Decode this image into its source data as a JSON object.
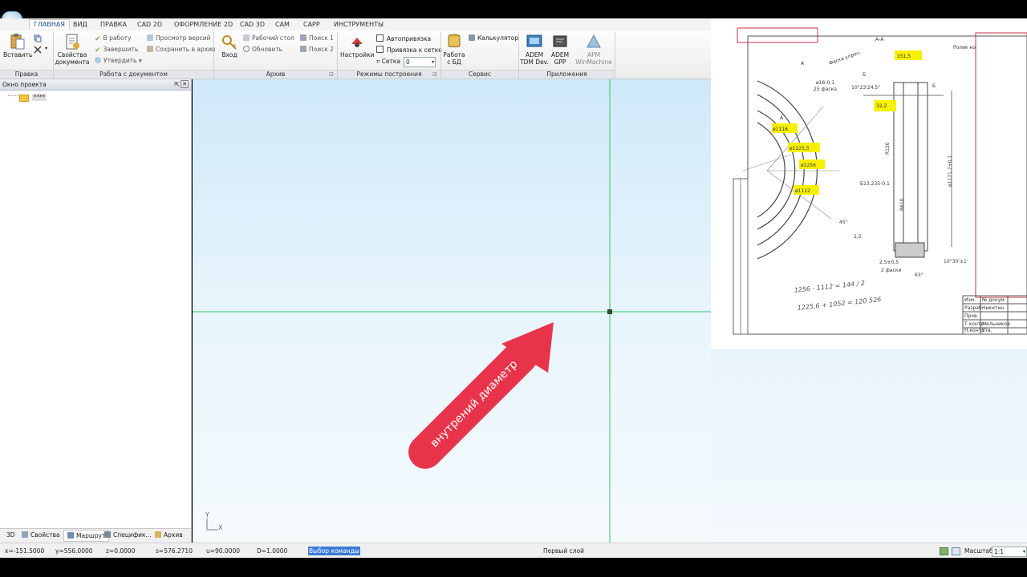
{
  "ribbon_tabs": [
    "ГЛАВНАЯ",
    "ВИД",
    "ПРАВКА",
    "CAD 2D",
    "ОФОРМЛЕНИЕ 2D",
    "CAD 3D",
    "CAM",
    "CAPP",
    "ИНСТРУМЕНТЫ"
  ],
  "groups": {
    "edit": {
      "label": "Правка",
      "paste": "Вставить"
    },
    "document": {
      "label": "Работа с документом",
      "properties": "Свойства\nдокумента",
      "to_work": "В работу",
      "finish": "Завершить",
      "approve": "Утвердить",
      "view_versions": "Просмотр версий",
      "save_archive": "Сохранить в архив"
    },
    "archive": {
      "label": "Архив",
      "login": "Вход",
      "desktop": "Рабочий стол",
      "refresh": "Обновить",
      "search1": "Поиск 1",
      "search2": "Поиск 2"
    },
    "modes": {
      "label": "Режимы построения",
      "settings": "Настройки",
      "autosnap": "Автопривязка",
      "grid_snap": "Привязка к сетке",
      "grid": "Сетка",
      "grid_value": "0"
    },
    "service": {
      "label": "Сервис",
      "db_work": "Работа\nс БД",
      "calculator": "Калькулятор"
    },
    "apps": {
      "label": "Приложения",
      "tdm": "ADEM\nTDM Dev.",
      "gpp": "ADEM\nGPP",
      "apm": "APM\nWinMachine"
    }
  },
  "project_panel": {
    "title": "Окно проекта",
    "tree_item": "****"
  },
  "panel_tabs": [
    "3D",
    "Свойства",
    "Маршрут",
    "Специфик...",
    "Архив"
  ],
  "canvas": {
    "arrow_text": "внутрений диаметр",
    "axis_y": "Y",
    "axis_x": "X"
  },
  "drawing": {
    "labels": [
      "А-А",
      "А",
      "А",
      "Б",
      "Б",
      "Ролик ко",
      "ø1116",
      "ø1225,5",
      "ø1256",
      "ø1112",
      "151,5",
      "32,2",
      "45°",
      "2,5",
      "10°23'24,5\"",
      "10°30'±1'",
      "63°",
      "R120",
      "R610",
      "ø1171,7±0,1",
      "Б13,235-0,1",
      "2,5±0,5",
      "2 фаски",
      "Фаска упроч.",
      "25 фаска",
      "ø16-0,1",
      "Изм.",
      "№ докум.",
      "Разраб.",
      "Никитин",
      "Пров.",
      "Т.контр.",
      "Н.контр.",
      "Утв.",
      "Мельников"
    ],
    "handwriting": [
      "1256 - 1112 = 144 / 2",
      "1225,6 + 1052 = 120  526"
    ]
  },
  "status": {
    "x": "x=-151.5000",
    "y": "y=556.0000",
    "z": "z=0.0000",
    "s": "s=576.2710",
    "u": "u=90.0000",
    "d": "D=1.0000",
    "command": "Выбор команды",
    "layer": "Первый слой",
    "scale_label": "Масштаб",
    "scale_value": "1:1"
  },
  "colors": {
    "arrow": "#e8344a",
    "highlight": "#f7f000",
    "guides": "#33c46a",
    "accent": "#1a4f8b"
  }
}
